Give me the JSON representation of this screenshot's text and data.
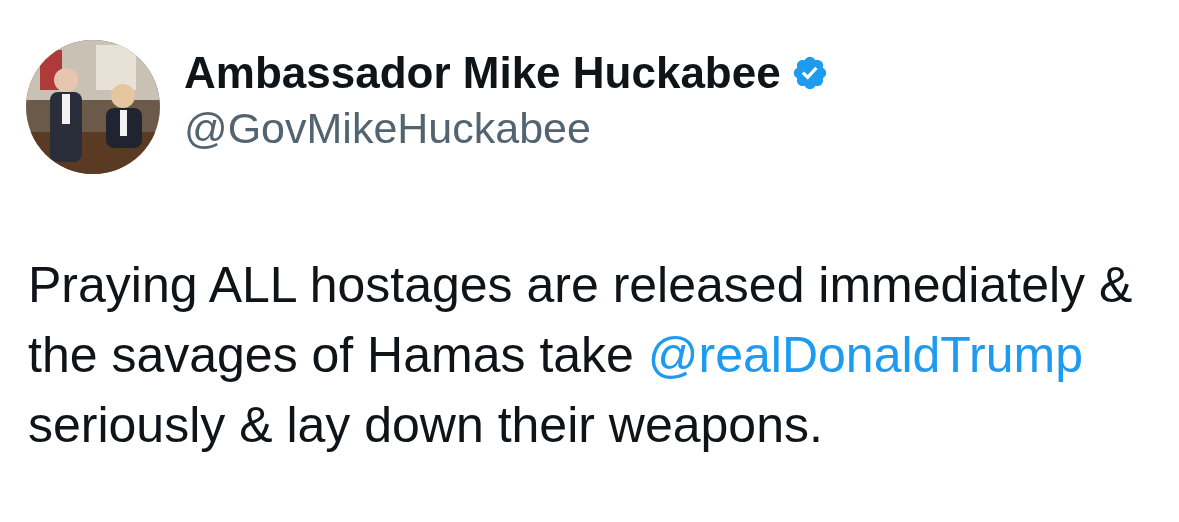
{
  "author": {
    "name": "Ambassador Mike Huckabee",
    "verified": true,
    "handle": "@GovMikeHuckabee"
  },
  "tweet": {
    "parts": [
      {
        "kind": "text",
        "text": "Praying ALL hostages are released immediately & the savages of Hamas take "
      },
      {
        "kind": "mention",
        "text": "@realDonaldTrump"
      },
      {
        "kind": "text",
        "text": " seriously & lay down their weapons."
      }
    ]
  }
}
